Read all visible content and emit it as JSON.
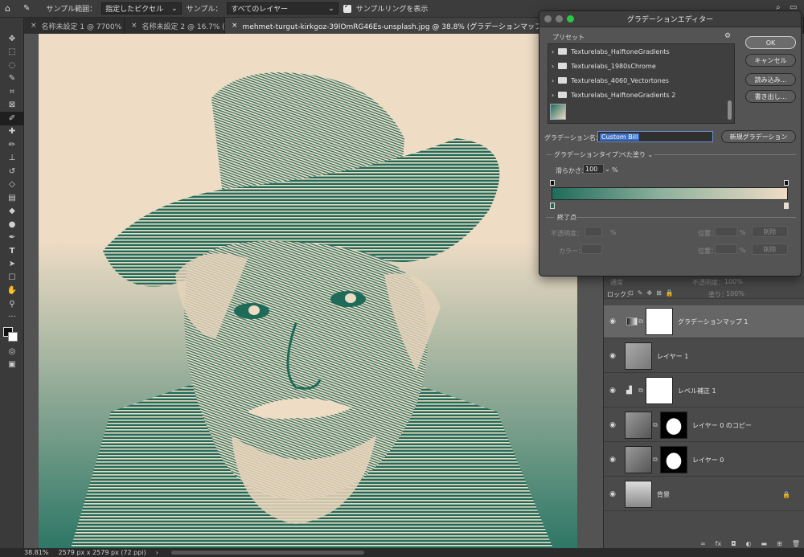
{
  "options_bar": {
    "sample_size_label": "サンプル範囲：",
    "sample_size_value": "指定したピクセル",
    "sample_label": "サンプル：",
    "sample_value": "すべてのレイヤー",
    "show_ring_label": "サンプルリングを表示"
  },
  "tabs": [
    {
      "label": "名称未設定 1 @ 7700% (グ..."
    },
    {
      "label": "名称未設定 2 @ 16.7% (グ..."
    },
    {
      "label": "mehmet-turgut-kirkgoz-39lOmRG46Es-unsplash.jpg @ 38.8% (グラデーションマップ 1, レイヤーマス"
    }
  ],
  "status": {
    "zoom": "38.81%",
    "doc_size": "2579 px x 2579 px (72 ppi)"
  },
  "dialog": {
    "title": "グラデーションエディター",
    "presets_label": "プリセット",
    "presets": [
      "Texturelabs_HalftoneGradients",
      "Texturelabs_1980sChrome",
      "Texturelabs_4060_Vectortones",
      "Texturelabs_HalftoneGradients 2"
    ],
    "ok": "OK",
    "cancel": "キャンセル",
    "load": "読み込み...",
    "save": "書き出し...",
    "name_label": "グラデーション名：",
    "name_value": "Custom Bill",
    "new_gradient": "新規グラデーション",
    "type_label": "グラデーションタイプ：",
    "type_value": "べた塗り",
    "smooth_label": "滑らかさ：",
    "smooth_value": "100",
    "smooth_unit": "%",
    "stops_label": "終了点",
    "opacity_label": "不透明度：",
    "opacity_unit": "%",
    "location_label": "位置：",
    "location_unit": "%",
    "delete_label": "削除",
    "color_label": "カラー：",
    "gradient_start": "#1f6b5a",
    "gradient_end": "#efdcc5"
  },
  "layers_panel": {
    "opacity_label": "不透明度：",
    "opacity_value": "100%",
    "lock_label": "ロック：",
    "fill_label": "塗り：",
    "fill_value": "100%",
    "blend_mode": "通常",
    "layers": [
      {
        "name": "グラデーションマップ 1"
      },
      {
        "name": "レイヤー 1"
      },
      {
        "name": "レベル補正 1"
      },
      {
        "name": "レイヤー 0 のコピー"
      },
      {
        "name": "レイヤー 0"
      },
      {
        "name": "背景"
      }
    ]
  },
  "colors": {
    "ink": "#1f6b5a",
    "paper": "#efdcc5"
  }
}
